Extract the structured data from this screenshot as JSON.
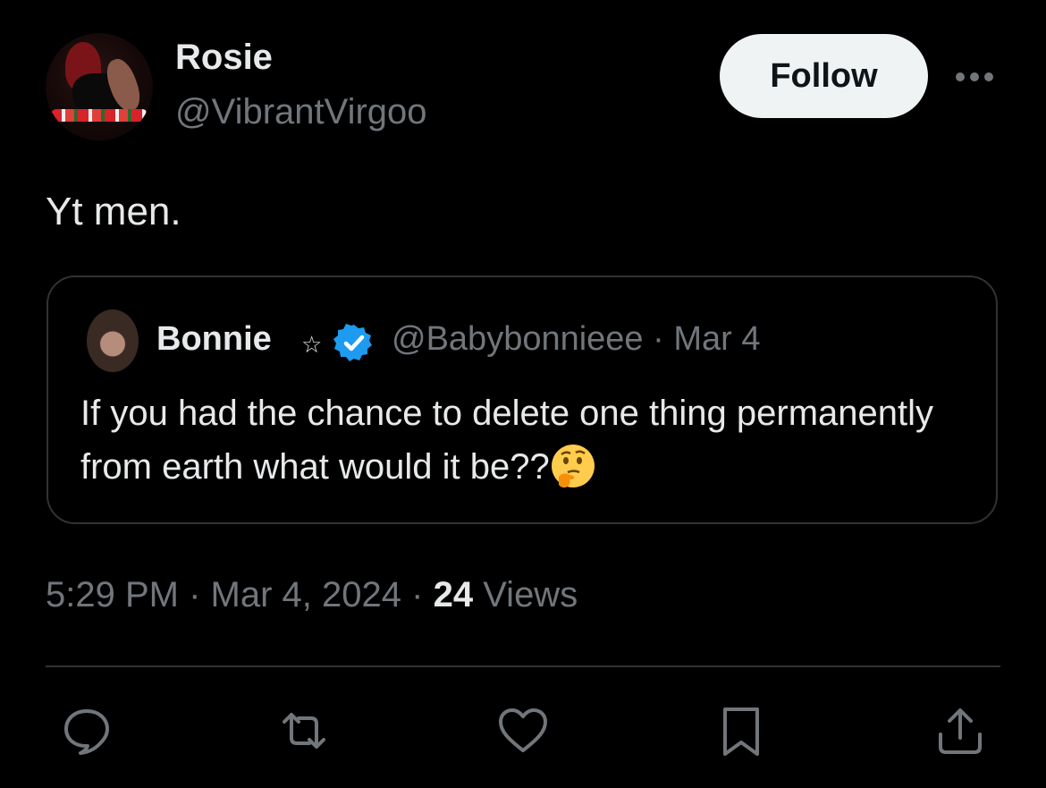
{
  "author": {
    "name": "Rosie",
    "handle": "@VibrantVirgoo"
  },
  "follow_label": "Follow",
  "tweet": {
    "text": "Yt men."
  },
  "quoted": {
    "name": "Bonnie",
    "name_symbol": "☆",
    "handle": "@Babybonnieee",
    "separator": "·",
    "date": "Mar 4",
    "text": "If you had the chance to delete one thing permanently from earth what would it be??",
    "emoji": "thinking-face",
    "verified_color": "#1d9bf0"
  },
  "meta": {
    "time": "5:29 PM",
    "sep1": "·",
    "date": "Mar 4, 2024",
    "sep2": "·",
    "views_count": "24",
    "views_label": "Views"
  },
  "actions": [
    "reply-icon",
    "retweet-icon",
    "like-icon",
    "bookmark-icon",
    "share-icon"
  ],
  "colors": {
    "background": "#000000",
    "primary_text": "#e7e9ea",
    "secondary_text": "#71767b",
    "border": "#2f3336",
    "follow_bg": "#eff3f4"
  }
}
